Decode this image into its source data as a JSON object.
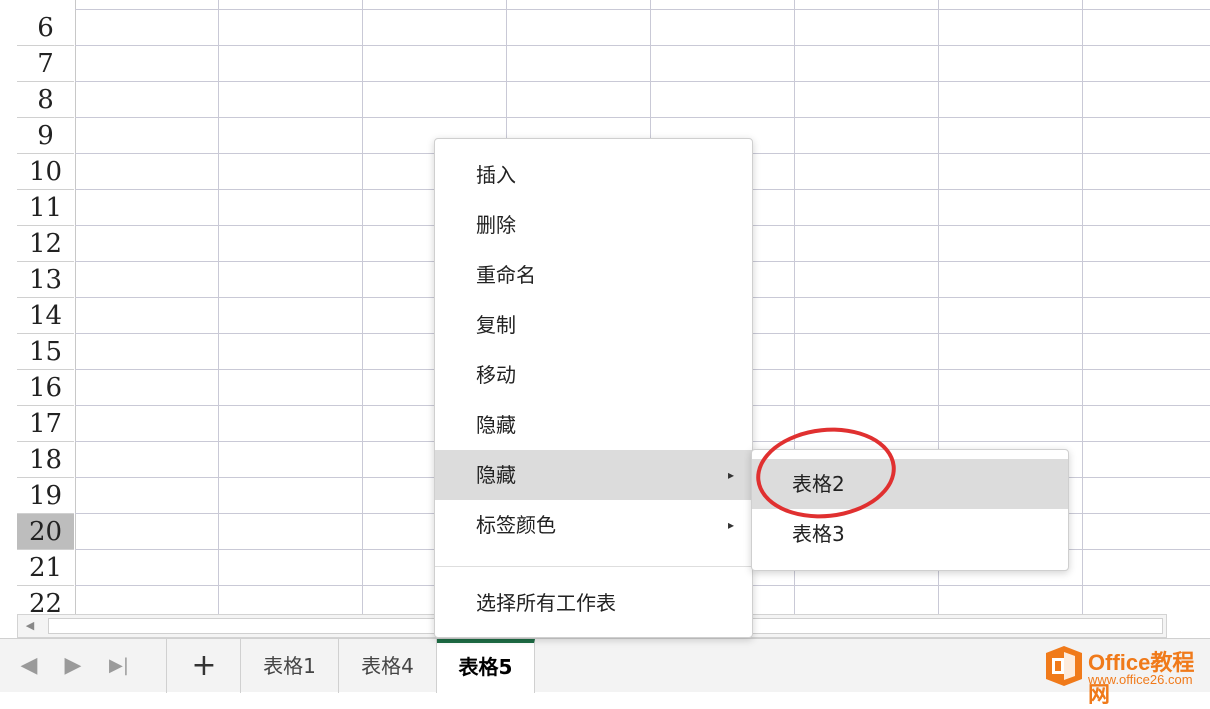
{
  "grid": {
    "row_numbers": [
      "6",
      "7",
      "8",
      "9",
      "10",
      "11",
      "12",
      "13",
      "14",
      "15",
      "16",
      "17",
      "18",
      "19",
      "20",
      "21",
      "22"
    ],
    "selected_row": "20"
  },
  "context_menu": {
    "items": [
      {
        "label": "插入"
      },
      {
        "label": "删除"
      },
      {
        "label": "重命名"
      },
      {
        "label": "复制"
      },
      {
        "label": "移动"
      },
      {
        "label": "隐藏"
      },
      {
        "label": "隐藏",
        "submenu": true
      },
      {
        "label": "标签颜色",
        "submenu": true
      },
      {
        "label": "选择所有工作表"
      }
    ],
    "submenu_arrow": "▸"
  },
  "submenu": {
    "items": [
      {
        "label": "表格2"
      },
      {
        "label": "表格3"
      }
    ]
  },
  "tabbar": {
    "add_symbol": "+",
    "nav": {
      "prev": "◀",
      "next": "▶",
      "last": "▶|"
    },
    "tabs": [
      {
        "label": "表格1"
      },
      {
        "label": "表格4"
      },
      {
        "label": "表格5",
        "active": true
      }
    ]
  },
  "watermark": {
    "name": "Office教程网",
    "url": "www.office26.com",
    "logo_icon": "office-logo-icon",
    "brand_color": "#f07a1a"
  },
  "colors": {
    "active_tab_accent": "#1e6e46",
    "highlight": "#dcdcdc",
    "annotation_ring": "#e03030"
  }
}
